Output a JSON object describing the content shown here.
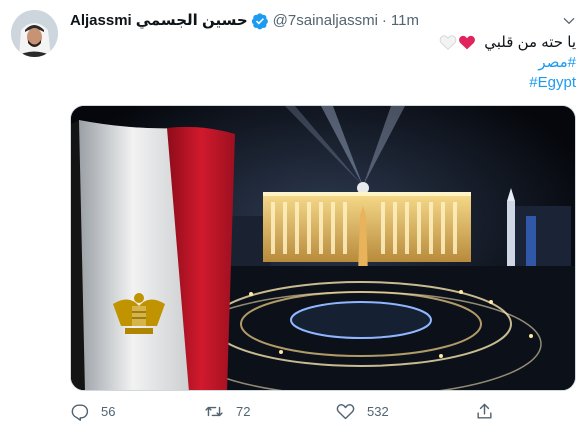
{
  "tweet": {
    "display_name": "حسين الجسمي",
    "username_label": "Aljassmi",
    "handle": "@7sainaljassmi",
    "separator": "·",
    "time": "11m",
    "text_line": "يا حته من قلبي",
    "hashtags": [
      "#مصر",
      "#Egypt"
    ],
    "emojis": [
      "red-heart",
      "white-heart"
    ],
    "image_alt_content": "Egyptian flag in front of illuminated Tahrir Square buildings at night"
  },
  "actions": {
    "reply_count": "56",
    "retweet_count": "72",
    "like_count": "532"
  },
  "colors": {
    "accent": "#1d9bf0",
    "text": "#0f1419",
    "muted": "#536471",
    "heart_red": "#e0245e",
    "flag_red": "#ce1126",
    "flag_black": "#111111",
    "eagle_gold": "#c09300"
  },
  "icons": {
    "verified": "verified-badge-icon",
    "more": "chevron-down-icon",
    "reply": "reply-icon",
    "retweet": "retweet-icon",
    "like": "like-icon",
    "share": "share-icon"
  }
}
